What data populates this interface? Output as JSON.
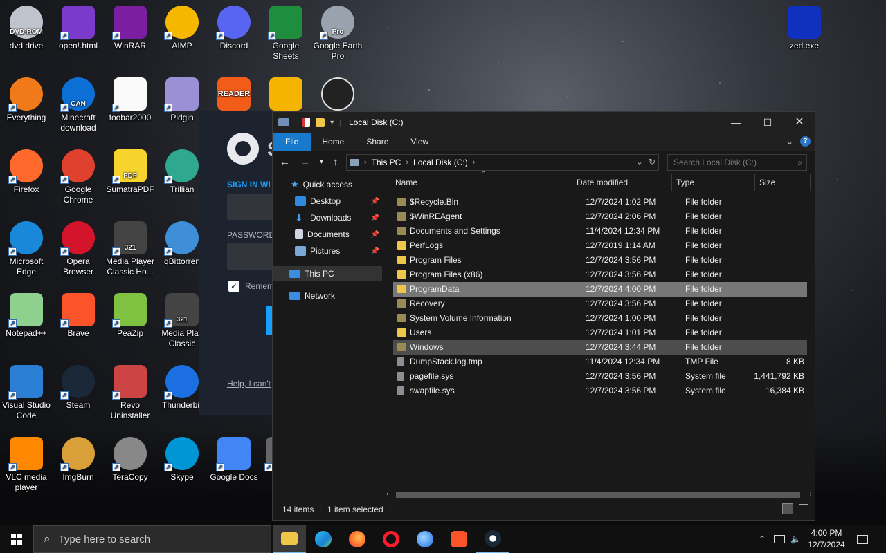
{
  "desktop": {
    "icons": [
      {
        "label": "dvd drive",
        "sub": "DVD-ROM"
      },
      {
        "label": "open!.html"
      },
      {
        "label": "WinRAR"
      },
      {
        "label": "AIMP"
      },
      {
        "label": "Discord"
      },
      {
        "label": "Google Sheets"
      },
      {
        "label": "Google Earth Pro",
        "sub": "Pro"
      },
      {
        "label": "zed.exe"
      },
      {
        "label": "Everything"
      },
      {
        "label": "Minecraft download",
        "badge": "CAN"
      },
      {
        "label": "foobar2000"
      },
      {
        "label": "Pidgin"
      },
      {
        "label": "Firefox"
      },
      {
        "label": "Google Chrome"
      },
      {
        "label": "SumatraPDF",
        "badge": "PDF"
      },
      {
        "label": "Trillian"
      },
      {
        "label": "Microsoft Edge"
      },
      {
        "label": "Opera Browser"
      },
      {
        "label": "Media Player Classic Ho...",
        "badge": "321"
      },
      {
        "label": "qBittorren"
      },
      {
        "label": "Notepad++"
      },
      {
        "label": "Brave"
      },
      {
        "label": "PeaZip"
      },
      {
        "label": "Media Play Classic",
        "badge": "321"
      },
      {
        "label": "Visual Studio Code"
      },
      {
        "label": "Steam"
      },
      {
        "label": "Revo Uninstaller"
      },
      {
        "label": "Thunderbir"
      },
      {
        "label": "VLC media player"
      },
      {
        "label": "ImgBurn"
      },
      {
        "label": "TeraCopy"
      },
      {
        "label": "Skype"
      },
      {
        "label": "Google Docs"
      },
      {
        "label": "P"
      }
    ],
    "partial_icon_texts": {
      "reader": "READER"
    }
  },
  "steam_login": {
    "brand_letter": "S",
    "sign_in": "SIGN IN WI",
    "password": "PASSWORD",
    "remember": "Remem",
    "help": "Help, I can't"
  },
  "explorer": {
    "title": "Local Disk (C:)",
    "ribbon_tabs": [
      "File",
      "Home",
      "Share",
      "View"
    ],
    "breadcrumb": [
      "This PC",
      "Local Disk (C:)"
    ],
    "search_placeholder": "Search Local Disk (C:)",
    "nav_pane": {
      "quick_access": "Quick access",
      "desktop": "Desktop",
      "downloads": "Downloads",
      "documents": "Documents",
      "pictures": "Pictures",
      "this_pc": "This PC",
      "network": "Network"
    },
    "columns": {
      "name": "Name",
      "date": "Date modified",
      "type": "Type",
      "size": "Size"
    },
    "files": [
      {
        "name": "$Recycle.Bin",
        "date": "12/7/2024 1:02 PM",
        "type": "File folder",
        "size": ""
      },
      {
        "name": "$WinREAgent",
        "date": "12/7/2024 2:06 PM",
        "type": "File folder",
        "size": ""
      },
      {
        "name": "Documents and Settings",
        "date": "11/4/2024 12:34 PM",
        "type": "File folder",
        "size": ""
      },
      {
        "name": "PerfLogs",
        "date": "12/7/2019 1:14 AM",
        "type": "File folder",
        "size": ""
      },
      {
        "name": "Program Files",
        "date": "12/7/2024 3:56 PM",
        "type": "File folder",
        "size": ""
      },
      {
        "name": "Program Files (x86)",
        "date": "12/7/2024 3:56 PM",
        "type": "File folder",
        "size": ""
      },
      {
        "name": "ProgramData",
        "date": "12/7/2024 4:00 PM",
        "type": "File folder",
        "size": ""
      },
      {
        "name": "Recovery",
        "date": "12/7/2024 3:56 PM",
        "type": "File folder",
        "size": ""
      },
      {
        "name": "System Volume Information",
        "date": "12/7/2024 1:00 PM",
        "type": "File folder",
        "size": ""
      },
      {
        "name": "Users",
        "date": "12/7/2024 1:01 PM",
        "type": "File folder",
        "size": ""
      },
      {
        "name": "Windows",
        "date": "12/7/2024 3:44 PM",
        "type": "File folder",
        "size": ""
      },
      {
        "name": "DumpStack.log.tmp",
        "date": "11/4/2024 12:34 PM",
        "type": "TMP File",
        "size": "8 KB"
      },
      {
        "name": "pagefile.sys",
        "date": "12/7/2024 3:56 PM",
        "type": "System file",
        "size": "1,441,792 KB"
      },
      {
        "name": "swapfile.sys",
        "date": "12/7/2024 3:56 PM",
        "type": "System file",
        "size": "16,384 KB"
      }
    ],
    "status": {
      "items": "14 items",
      "selected": "1 item selected"
    }
  },
  "taskbar": {
    "search_placeholder": "Type here to search",
    "time": "4:00 PM",
    "date": "12/7/2024"
  },
  "colors": {
    "accent": "#1979ca",
    "folder": "#f0c64a",
    "selection": "#777777"
  }
}
